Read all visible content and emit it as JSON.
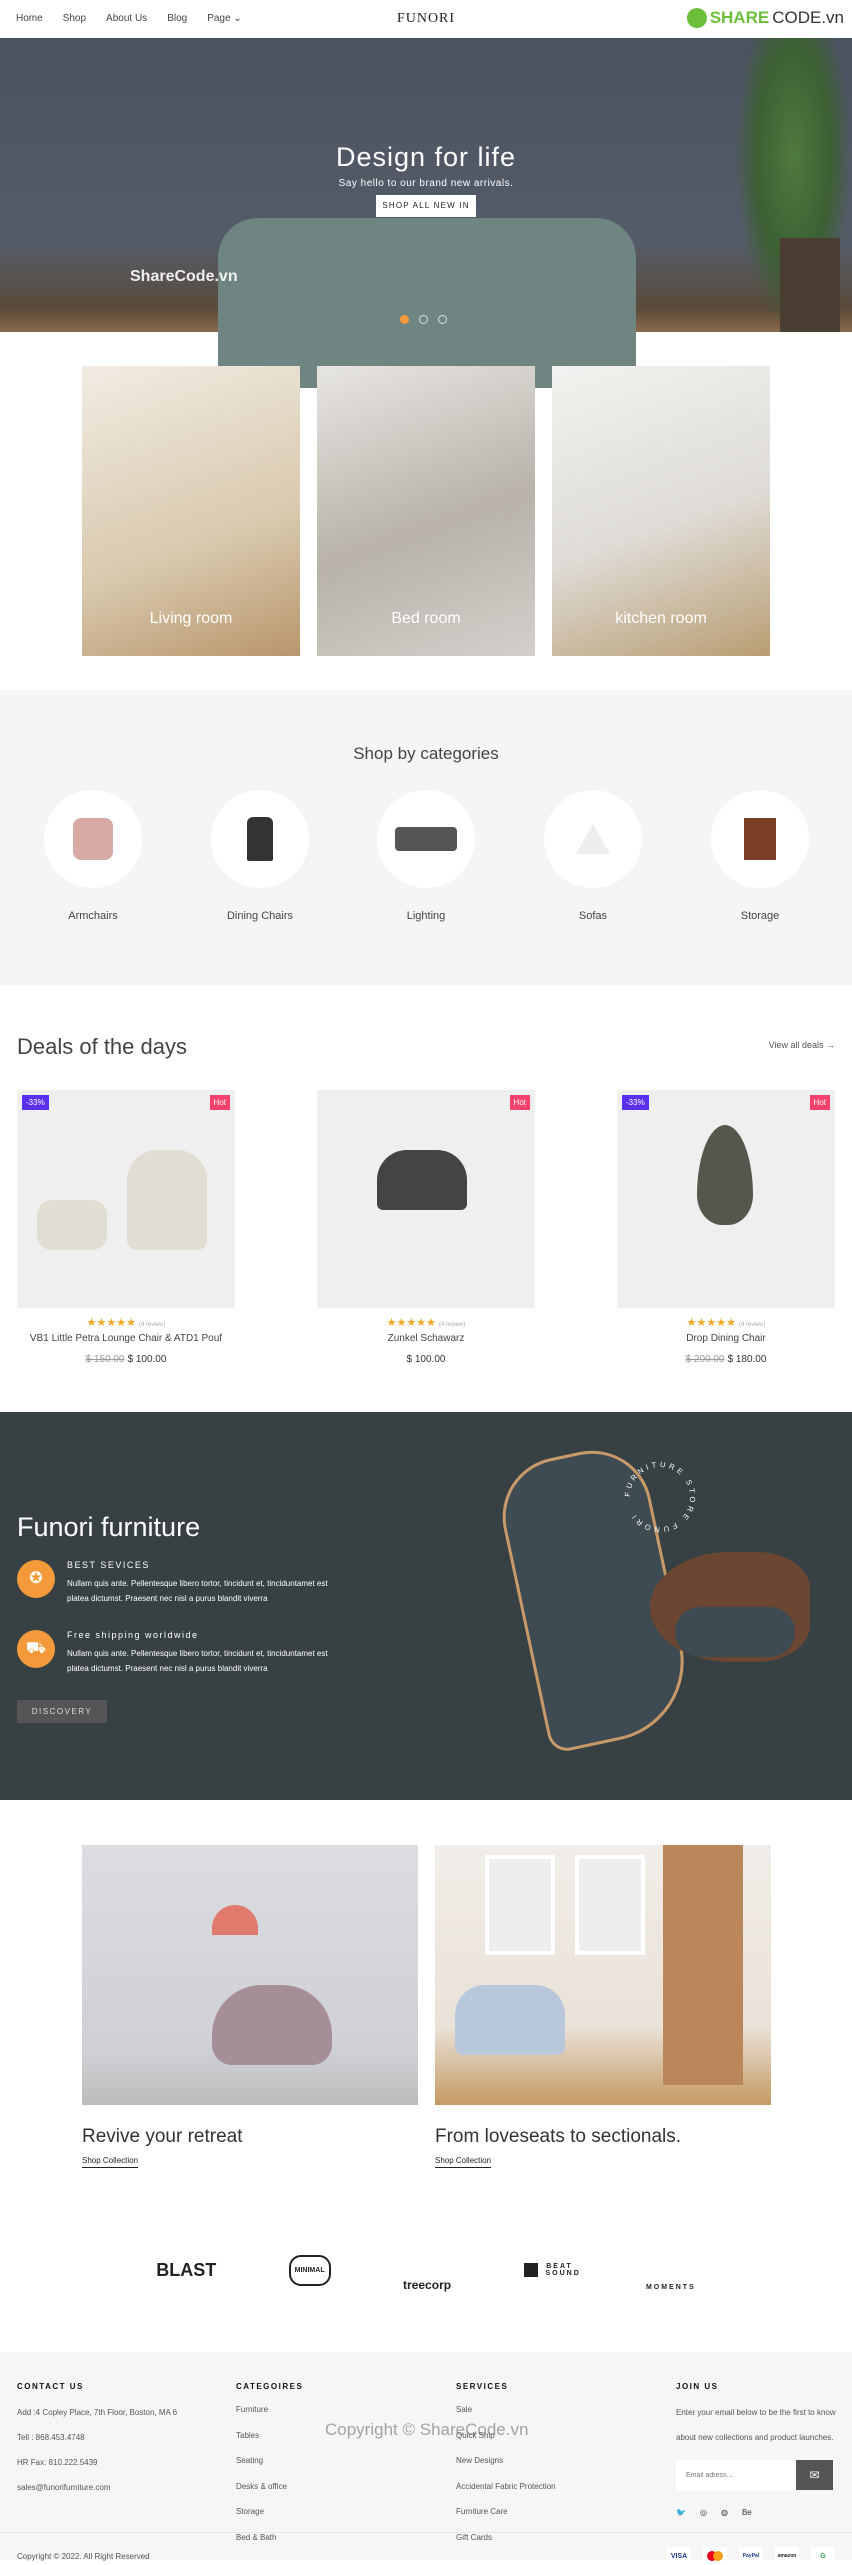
{
  "nav": {
    "links": [
      "Home",
      "Shop",
      "About Us",
      "Blog",
      "Page"
    ],
    "logo": "FUNORI",
    "sharecode": "SHARECODE.vn"
  },
  "hero": {
    "title": "Design for life",
    "subtitle": "Say hello to our brand new arrivals.",
    "button": "SHOP ALL NEW IN",
    "watermark": "ShareCode.vn",
    "slides": 3,
    "active_slide": 1
  },
  "rooms": [
    "Living room",
    "Bed room",
    "kitchen room"
  ],
  "categories": {
    "title": "Shop by categories",
    "items": [
      {
        "label": "Armchairs",
        "icon": "armchair-icon"
      },
      {
        "label": "Dining Chairs",
        "icon": "dining-chair-icon"
      },
      {
        "label": "Lighting",
        "icon": "sofa-icon"
      },
      {
        "label": "Sofas",
        "icon": "lamp-icon"
      },
      {
        "label": "Storage",
        "icon": "cabinet-icon"
      }
    ]
  },
  "deals": {
    "title": "Deals of the days",
    "view_all": "View all deals →",
    "products": [
      {
        "name": "VB1 Little Petra Lounge Chair & ATD1 Pouf",
        "old_price": "$ 150.00",
        "price": "$ 100.00",
        "discount": "-33%",
        "hot": "Hot",
        "stars": "★★★★★",
        "reviews": "(4 review)",
        "rating": 5
      },
      {
        "name": "Zunkel Schawarz",
        "old_price": "",
        "price": "$ 100.00",
        "discount": "",
        "hot": "Hot",
        "stars": "★★★★★",
        "reviews": "(4 review)",
        "rating": 5
      },
      {
        "name": "Drop Dining Chair",
        "old_price": "$ 200.00",
        "price": "$ 180.00",
        "discount": "-33%",
        "hot": "Hot",
        "stars": "★★★★★",
        "reviews": "(4 review)",
        "rating": 5
      }
    ]
  },
  "promo": {
    "title": "Funori furniture",
    "badge_text": "FURNITURE STORE FUNORI",
    "features": [
      {
        "title": "BEST SEVICES",
        "text": "Nullam quis ante. Pellentesque libero tortor, tincidunt et, tinciduntamet est platea dictumst. Praesent nec nisl a purus blandit viverra",
        "icon": "award-icon"
      },
      {
        "title": "Free shipping worldwide",
        "text": "Nullam quis ante. Pellentesque libero tortor, tincidunt et, tinciduntamet est platea dictumst. Praesent nec nisl a purus blandit viverra",
        "icon": "truck-icon"
      }
    ],
    "button": "DISCOVERY"
  },
  "collections": [
    {
      "title": "Revive your retreat",
      "link": "Shop Collection"
    },
    {
      "title": "From loveseats to sectionals.",
      "link": "Shop Collection"
    }
  ],
  "brands": [
    "BLAST",
    "MINIMAL",
    "treecorp",
    "BEAT SOUND",
    "MOMENTS"
  ],
  "footer": {
    "contact": {
      "title": "CONTACT US",
      "lines": [
        "Add :4 Copley Place, 7th Floor, Boston, MA 6",
        "Tell : 868.453.4748",
        "HR Fax: 810.222.5439",
        "sales@funorifurniture.com"
      ]
    },
    "categories": {
      "title": "CATEGOIRES",
      "items": [
        "Furniture",
        "Tables",
        "Seating",
        "Desks & office",
        "Storage",
        "Bed & Bath"
      ]
    },
    "services": {
      "title": "SERVICES",
      "items": [
        "Sale",
        "Quick Ship",
        "New Designs",
        "Accidental Fabric Protection",
        "Furniture Care",
        "Gift Cards"
      ]
    },
    "join": {
      "title": "JOIN US",
      "text": "Enter your email below to be the first to know about new collections and product launches.",
      "placeholder": "Email adress...",
      "social": [
        "🐦",
        "◎",
        "◍",
        "Be"
      ]
    },
    "copyright": "Copyright © 2022. All Right Reserved",
    "watermark": "Copyright © ShareCode.vn",
    "payments": [
      "VISA",
      "MC",
      "PayPal",
      "amazon",
      "G"
    ]
  },
  "colors": {
    "accent": "#f59a3a",
    "dark_section": "#374144",
    "discount_badge": "#5b2ff0",
    "hot_badge": "#f4426c",
    "star": "#f5a623"
  }
}
